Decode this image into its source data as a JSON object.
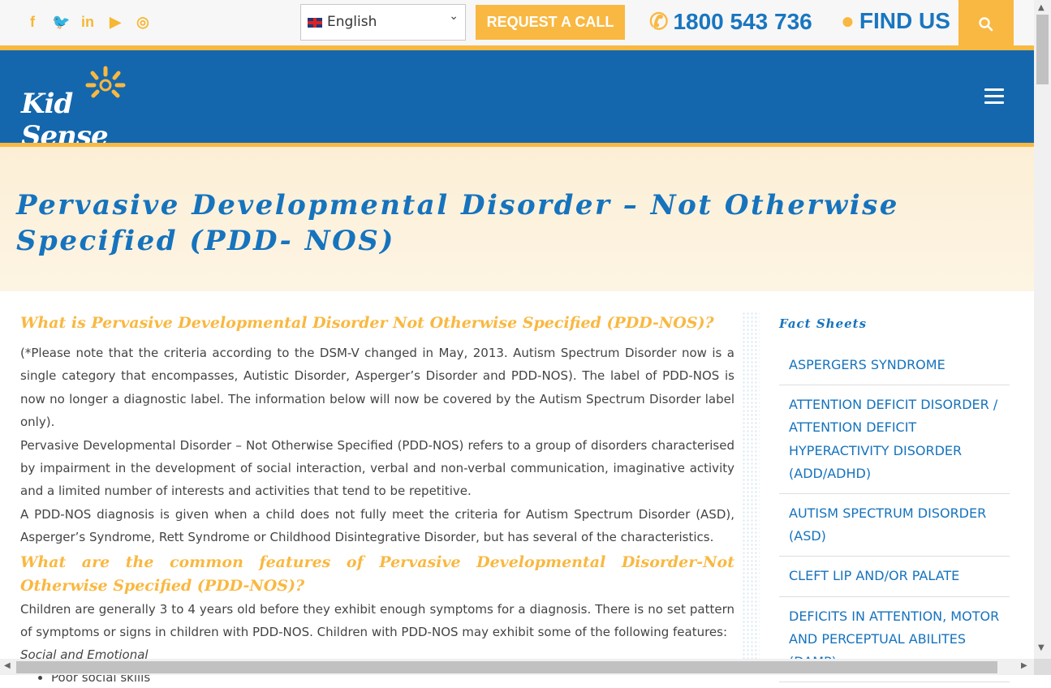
{
  "topbar": {
    "social_icons": [
      "facebook-icon",
      "twitter-icon",
      "linkedin-icon",
      "youtube-icon",
      "instagram-icon"
    ],
    "social_glyphs": [
      "f",
      "🐦",
      "in",
      "▶",
      "◎"
    ],
    "language": "English",
    "request_call": "REQUEST A CALL",
    "phone": "1800 543 736",
    "find_us": "FIND US"
  },
  "header": {
    "logo_text": "Kid Sense"
  },
  "hero": {
    "title": "Pervasive Developmental Disorder – Not Otherwise Specified (PDD- NOS)"
  },
  "main": {
    "heading1": "What is Pervasive Developmental Disorder Not Otherwise Specified (PDD-NOS)?",
    "para1": "(*Please note that the criteria according to the DSM-V changed in May, 2013. Autism Spectrum Disorder now is a single category that encompasses, Autistic Disorder, Asperger’s Disorder and PDD-NOS). The label of PDD-NOS is now no longer a diagnostic label. The information below will now be covered by the Autism Spectrum Disorder label only).",
    "para2": "Pervasive Developmental Disorder – Not Otherwise Specified (PDD-NOS) refers to a group of disorders characterised by impairment in the development of social interaction, verbal and non-verbal communication, imaginative activity and a limited number of interests and activities that tend to be repetitive.",
    "para3": "A PDD-NOS diagnosis is given when a child does not fully meet the criteria for Autism Spectrum Disorder (ASD), Asperger’s Syndrome, Rett Syndrome or Childhood Disintegrative Disorder, but has several of the characteristics.",
    "heading2": "What are the common features of Pervasive Developmental Disorder-Not Otherwise Specified (PDD-NOS)?",
    "para4": "Children are generally 3 to 4 years old before they exhibit enough symptoms for a diagnosis. There is no set pattern of symptoms or signs in children with PDD-NOS. Children with PDD-NOS may exhibit some of the following features:",
    "subheading": "Social and Emotional",
    "bullets": [
      "Poor social skills"
    ]
  },
  "sidebar": {
    "title": "Fact Sheets",
    "items": [
      "ASPERGERS SYNDROME",
      "ATTENTION DEFICIT DISORDER / ATTENTION DEFICIT HYPERACTIVITY DISORDER (ADD/ADHD)",
      "AUTISM SPECTRUM DISORDER (ASD)",
      "CLEFT LIP AND/OR PALATE",
      "DEFICITS IN ATTENTION, MOTOR AND PERCEPTUAL ABILITES (DAMP)"
    ]
  },
  "colors": {
    "brand_blue": "#1467ad",
    "accent_yellow": "#f9b841",
    "link_blue": "#1673bd"
  }
}
